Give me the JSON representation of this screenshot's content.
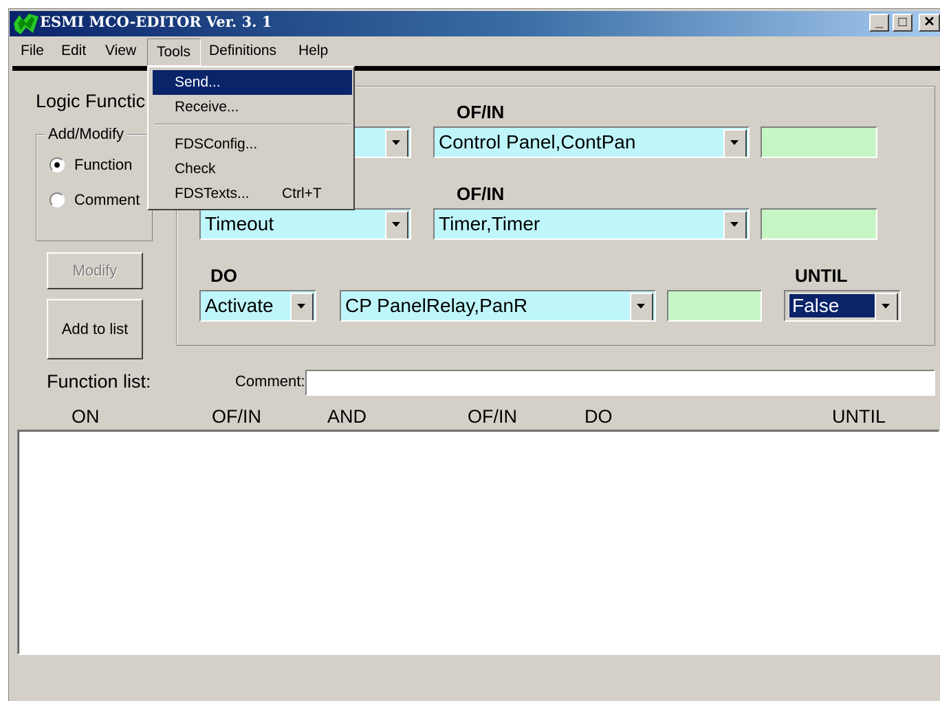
{
  "window": {
    "title": "ESMI MCO-EDITOR  Ver. 3. 1",
    "controls": {
      "minimize": "_",
      "maximize": "□",
      "close": "✕"
    }
  },
  "menu": {
    "items": [
      "File",
      "Edit",
      "View",
      "Tools",
      "Definitions",
      "Help"
    ],
    "active": "Tools"
  },
  "tools_menu": {
    "send": "Send...",
    "receive": "Receive...",
    "fdsconfig": "FDSConfig...",
    "check": "Check",
    "fdstexts": "FDSTexts...",
    "fdstexts_shortcut": "Ctrl+T"
  },
  "left_panel": {
    "heading": "Logic Functic",
    "group_label": "Add/Modify",
    "radio_function": "Function",
    "radio_comment": "Comment",
    "modify_button": "Modify",
    "add_button": "Add to list",
    "function_list_label": "Function list:"
  },
  "editor": {
    "row1": {
      "ofin_label": "OF/IN",
      "ofin_value": "Control Panel,ContPan"
    },
    "row2": {
      "on_value": "Timeout",
      "ofin_label": "OF/IN",
      "ofin_value": "Timer,Timer"
    },
    "row3": {
      "do_label": "DO",
      "do_action": "Activate",
      "do_target": "CP PanelRelay,PanR",
      "until_label": "UNTIL",
      "until_value": "False"
    }
  },
  "comment": {
    "label": "Comment:",
    "value": ""
  },
  "columns": [
    "ON",
    "OF/IN",
    "AND",
    "OF/IN",
    "DO",
    "UNTIL"
  ]
}
